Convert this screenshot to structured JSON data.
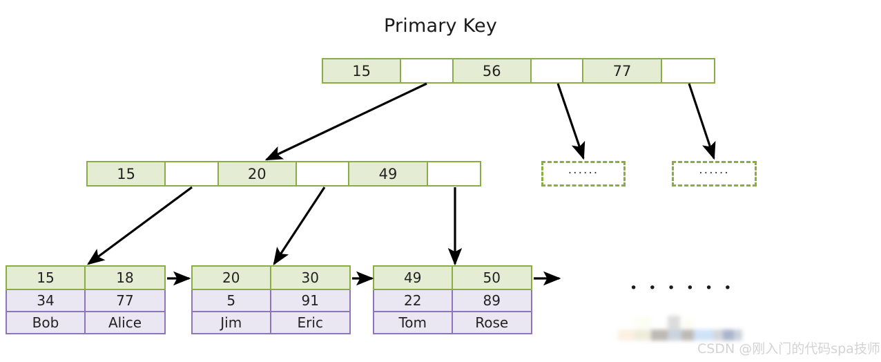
{
  "title": "Primary Key",
  "colors": {
    "key_fill": "#e4edd3",
    "key_border": "#8aac45",
    "data_fill": "#ebe7f2",
    "data_border": "#8e74b8",
    "arrow": "#000000",
    "text": "#222222",
    "watermark": "#d3d3d3"
  },
  "root_node": {
    "name": "root-index-node",
    "cells": [
      {
        "value": "15",
        "type": "key"
      },
      {
        "value": "",
        "type": "pointer"
      },
      {
        "value": "56",
        "type": "key"
      },
      {
        "value": "",
        "type": "pointer"
      },
      {
        "value": "77",
        "type": "key"
      },
      {
        "value": "",
        "type": "pointer"
      }
    ]
  },
  "internal_node": {
    "name": "internal-index-node",
    "cells": [
      {
        "value": "15",
        "type": "key"
      },
      {
        "value": "",
        "type": "pointer"
      },
      {
        "value": "20",
        "type": "key"
      },
      {
        "value": "",
        "type": "pointer"
      },
      {
        "value": "49",
        "type": "key"
      },
      {
        "value": "",
        "type": "pointer"
      }
    ]
  },
  "placeholder_nodes": [
    {
      "label": "······"
    },
    {
      "label": "······"
    }
  ],
  "leaf_nodes": [
    {
      "keys": [
        "15",
        "18"
      ],
      "values": [
        "34",
        "77"
      ],
      "names": [
        "Bob",
        "Alice"
      ]
    },
    {
      "keys": [
        "20",
        "30"
      ],
      "values": [
        "5",
        "91"
      ],
      "names": [
        "Jim",
        "Eric"
      ]
    },
    {
      "keys": [
        "49",
        "50"
      ],
      "values": [
        "22",
        "89"
      ],
      "names": [
        "Tom",
        "Rose"
      ]
    }
  ],
  "side_ellipsis": "• • • • • •",
  "watermark": "CSDN @刚入门的代码spa技师"
}
